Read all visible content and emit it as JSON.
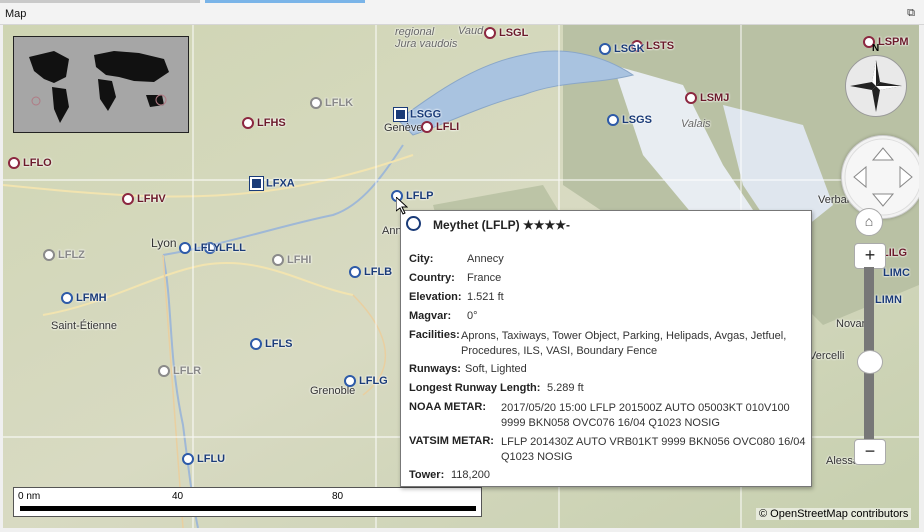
{
  "window": {
    "title": "Map",
    "float_icon": "restore-icon"
  },
  "map": {
    "overview_label": "world-overview-map",
    "airports": [
      {
        "id": "LSGL",
        "label": "LSGL",
        "kind": "civ"
      },
      {
        "id": "LSTS",
        "label": "LSTS",
        "kind": "civ"
      },
      {
        "id": "LSGK",
        "label": "LSGK",
        "kind": "mil"
      },
      {
        "id": "LSPM",
        "label": "LSPM",
        "kind": "civ"
      },
      {
        "id": "LSMJ",
        "label": "LSMJ",
        "kind": "civ"
      },
      {
        "id": "LFLK",
        "label": "LFLK",
        "kind": "gray"
      },
      {
        "id": "LSGG",
        "label": "LSGG",
        "kind": "mil"
      },
      {
        "id": "LFLI",
        "label": "LFLI",
        "kind": "civ"
      },
      {
        "id": "LFHS",
        "label": "LFHS",
        "kind": "civ"
      },
      {
        "id": "LSGS",
        "label": "LSGS",
        "kind": "mil"
      },
      {
        "id": "LFLO",
        "label": "LFLO",
        "kind": "civ"
      },
      {
        "id": "LFXA",
        "label": "LFXA",
        "kind": "mil"
      },
      {
        "id": "LFLP",
        "label": "LFLP",
        "kind": "mil"
      },
      {
        "id": "LFHV",
        "label": "LFHV",
        "kind": "civ"
      },
      {
        "id": "LFLL",
        "label": "LFLL",
        "kind": "mil"
      },
      {
        "id": "LFLY",
        "label": "LFLY",
        "kind": "mil"
      },
      {
        "id": "LFLZ",
        "label": "LFLZ",
        "kind": "gray"
      },
      {
        "id": "LFHI",
        "label": "LFHI",
        "kind": "gray"
      },
      {
        "id": "LFLB",
        "label": "LFLB",
        "kind": "mil"
      },
      {
        "id": "LILG",
        "label": "LILG",
        "kind": "civ"
      },
      {
        "id": "LIMC",
        "label": "LIMC",
        "kind": "mil"
      },
      {
        "id": "LIMN",
        "label": "LIMN",
        "kind": "mil"
      },
      {
        "id": "LFMH",
        "label": "LFMH",
        "kind": "mil"
      },
      {
        "id": "LFLS",
        "label": "LFLS",
        "kind": "mil"
      },
      {
        "id": "LFLR",
        "label": "LFLR",
        "kind": "gray"
      },
      {
        "id": "LFLG",
        "label": "LFLG",
        "kind": "mil"
      },
      {
        "id": "LFLU",
        "label": "LFLU",
        "kind": "mil"
      }
    ],
    "places": [
      "regional",
      "Jura vaudois",
      "Vaud",
      "Genève",
      "Annecy",
      "Lyon",
      "Saint-Étienne",
      "Grenoble",
      "Verbania",
      "Novara",
      "Vercelli",
      "Alessa",
      "Valais"
    ],
    "compass_n": "N",
    "zoom_in": "+",
    "zoom_out": "−",
    "scale": {
      "labels": [
        "0 nm",
        "40",
        "80"
      ]
    },
    "attribution": "© OpenStreetMap contributors"
  },
  "tooltip": {
    "title": "Meythet (LFLP) ★★★★-",
    "rows": [
      {
        "key": "City:",
        "value": "Annecy"
      },
      {
        "key": "Country:",
        "value": "France"
      },
      {
        "key": "Elevation:",
        "value": "1.521 ft"
      },
      {
        "key": "Magvar:",
        "value": "0°"
      },
      {
        "key": "Facilities:",
        "value": "Aprons, Taxiways, Tower Object, Parking, Helipads, Avgas, Jetfuel, Procedures, ILS, VASI, Boundary Fence"
      },
      {
        "key": "Runways:",
        "value": "Soft, Lighted"
      },
      {
        "key": "Longest Runway Length:",
        "value": "5.289 ft"
      },
      {
        "key": "NOAA METAR:",
        "value": "2017/05/20 15:00 LFLP 201500Z AUTO 05003KT 010V100 9999 BKN058 OVC076 16/04 Q1023 NOSIG"
      },
      {
        "key": "VATSIM METAR:",
        "value": "LFLP 201430Z AUTO VRB01KT 9999 BKN056 OVC080 16/04 Q1023 NOSIG"
      },
      {
        "key": "Tower:",
        "value": "118,200"
      }
    ]
  }
}
